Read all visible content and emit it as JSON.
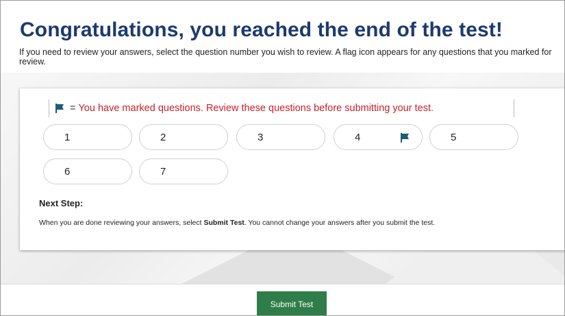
{
  "page": {
    "title": "Congratulations, you reached the end of the test!",
    "instructions": "If you need to review your answers, select the question number you wish to review. A flag icon appears for any questions that you marked for review."
  },
  "notice": {
    "equals": "=",
    "text": "You have marked questions. Review these questions before submitting your test.",
    "color": "#c8202a"
  },
  "questions": [
    {
      "label": "1",
      "flagged": false
    },
    {
      "label": "2",
      "flagged": false
    },
    {
      "label": "3",
      "flagged": false
    },
    {
      "label": "4",
      "flagged": true
    },
    {
      "label": "5",
      "flagged": false
    },
    {
      "label": "6",
      "flagged": false
    },
    {
      "label": "7",
      "flagged": false
    }
  ],
  "next_step": {
    "heading": "Next Step:",
    "desc_before": "When you are done reviewing your answers, select ",
    "desc_bold": "Submit Test",
    "desc_after": ". You cannot change your answers after you submit the test."
  },
  "footer": {
    "submit_label": "Submit Test",
    "submit_color": "#2f7d49"
  },
  "colors": {
    "title": "#1d3a6e",
    "flag": "#1a5d74"
  }
}
